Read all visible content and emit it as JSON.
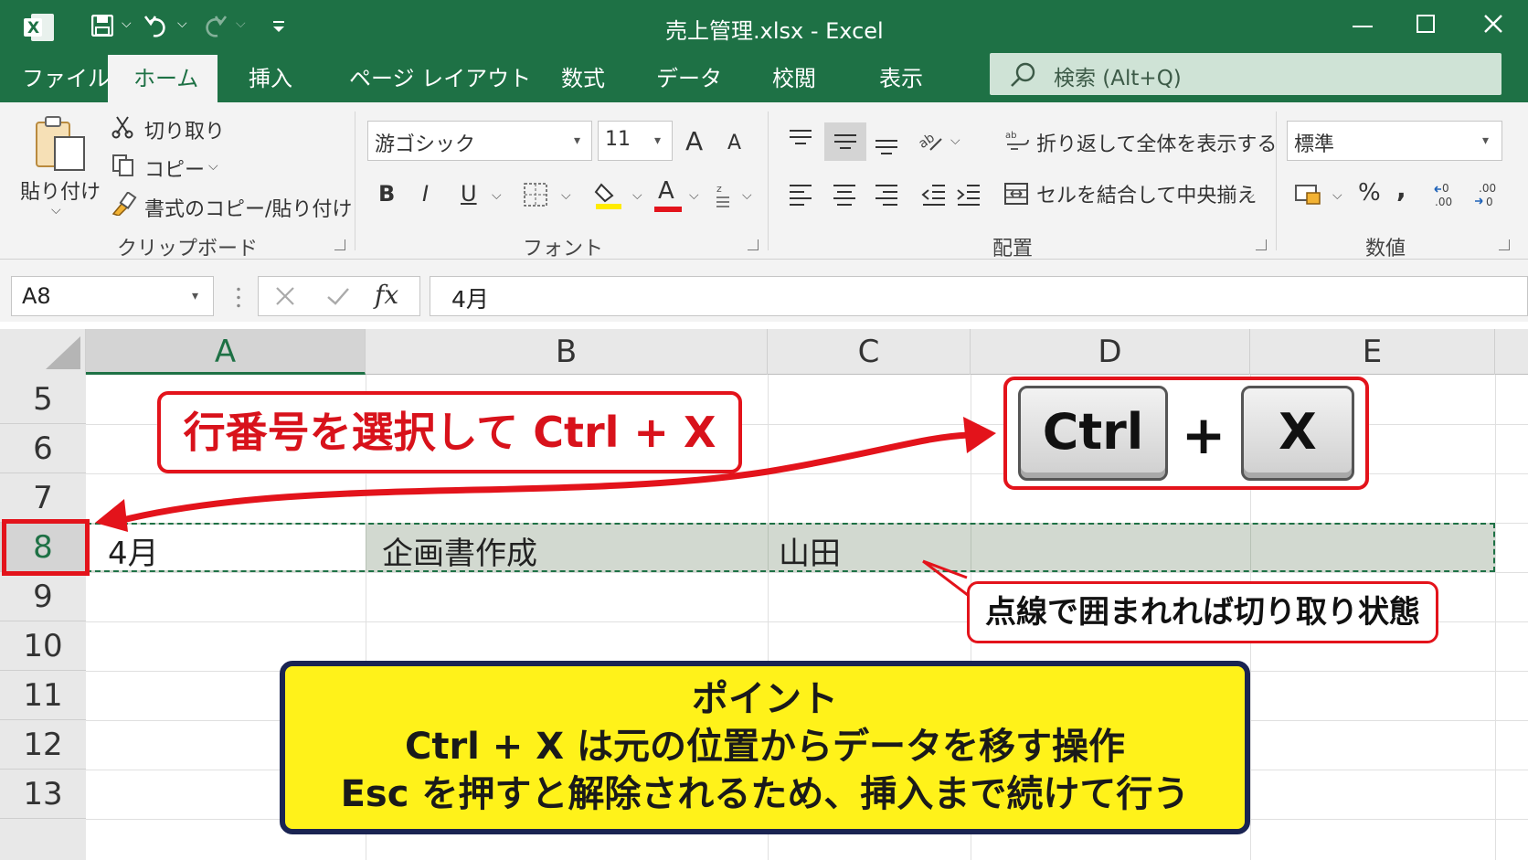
{
  "window": {
    "title": "売上管理.xlsx  -  Excel"
  },
  "tabs": [
    "ファイル",
    "ホーム",
    "挿入",
    "ページ レイアウト",
    "数式",
    "データ",
    "校閲",
    "表示"
  ],
  "active_tab": "ホーム",
  "search": {
    "placeholder": "検索 (Alt+Q)"
  },
  "ribbon": {
    "clipboard": {
      "paste": "貼り付け",
      "cut": "切り取り",
      "copy": "コピー",
      "format_painter": "書式のコピー/貼り付け",
      "label": "クリップボード"
    },
    "font": {
      "font_name": "游ゴシック",
      "font_size": "11",
      "grow": "A",
      "shrink": "A",
      "bold": "B",
      "italic": "I",
      "underline": "U",
      "font_color_letter": "A",
      "label": "フォント"
    },
    "alignment": {
      "wrap_text": "折り返して全体を表示する",
      "merge_center": "セルを結合して中央揃え",
      "label": "配置"
    },
    "number": {
      "format": "標準",
      "percent": "%",
      "comma": ",",
      "label": "数値"
    }
  },
  "formula_bar": {
    "name_box": "A8",
    "fx": "fx",
    "content": "4月"
  },
  "columns": [
    "A",
    "B",
    "C",
    "D",
    "E"
  ],
  "rows": [
    "5",
    "6",
    "7",
    "8",
    "9",
    "10",
    "11",
    "12",
    "13"
  ],
  "selected_row": "8",
  "row8": {
    "a": "4月",
    "b": "企画書作成",
    "c": "山田"
  },
  "annotations": {
    "instruction": "行番号を選択して Ctrl + X",
    "key_ctrl": "Ctrl",
    "key_plus": "+",
    "key_x": "X",
    "dashed_note": "点線で囲まれれば切り取り状態",
    "point_title": "ポイント",
    "point_line1": "Ctrl + X は元の位置からデータを移す操作",
    "point_line2": "Esc を押すと解除されるため、挿入まで続けて行う"
  },
  "colors": {
    "excel_green": "#1e7145",
    "red": "#e3131b",
    "yellow": "#fff21a",
    "navy": "#1a2452",
    "cut_fill": "#d2d9d0"
  }
}
